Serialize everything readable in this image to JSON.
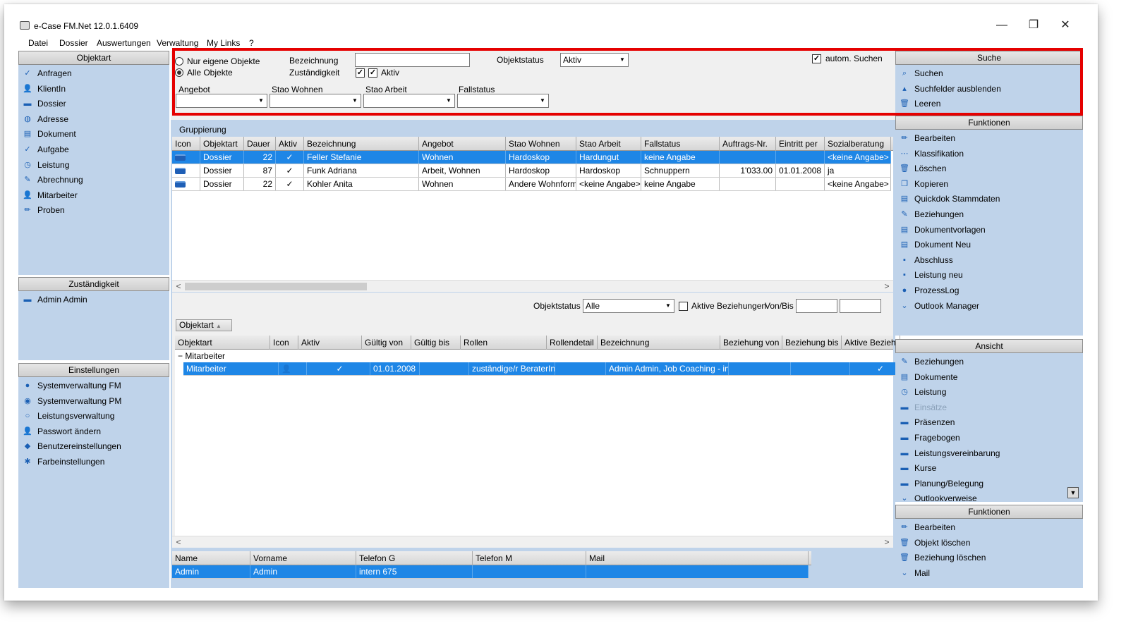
{
  "window": {
    "title": "e-Case FM.Net 12.0.1.6409",
    "min": "—",
    "max": "❐",
    "close": "✕"
  },
  "menu": [
    "Datei",
    "Dossier",
    "Auswertungen",
    "Verwaltung",
    "My Links",
    "?"
  ],
  "left": {
    "objektart": {
      "title": "Objektart",
      "items": [
        {
          "label": "Anfragen",
          "icon": "check-icon",
          "glyph": "✓"
        },
        {
          "label": "KlientIn",
          "icon": "person-icon",
          "glyph": "👤"
        },
        {
          "label": "Dossier",
          "icon": "dossier-icon",
          "glyph": "▬"
        },
        {
          "label": "Adresse",
          "icon": "globe-icon",
          "glyph": "◍"
        },
        {
          "label": "Dokument",
          "icon": "document-icon",
          "glyph": "▤"
        },
        {
          "label": "Aufgabe",
          "icon": "check-icon",
          "glyph": "✓"
        },
        {
          "label": "Leistung",
          "icon": "clock-icon",
          "glyph": "◷"
        },
        {
          "label": "Abrechnung",
          "icon": "invoice-icon",
          "glyph": "✎"
        },
        {
          "label": "Mitarbeiter",
          "icon": "person-icon",
          "glyph": "👤"
        },
        {
          "label": "Proben",
          "icon": "pen-icon",
          "glyph": "✏"
        }
      ]
    },
    "zustaendigkeit": {
      "title": "Zuständigkeit",
      "items": [
        {
          "label": "Admin Admin",
          "icon": "dossier-icon",
          "glyph": "▬"
        }
      ]
    },
    "einstellungen": {
      "title": "Einstellungen",
      "items": [
        {
          "label": "Systemverwaltung FM",
          "icon": "gear-icon",
          "glyph": "●"
        },
        {
          "label": "Systemverwaltung PM",
          "icon": "gear-icon",
          "glyph": "◉"
        },
        {
          "label": "Leistungsverwaltung",
          "icon": "settings-icon",
          "glyph": "○"
        },
        {
          "label": "Passwort ändern",
          "icon": "key-icon",
          "glyph": "👤"
        },
        {
          "label": "Benutzereinstellungen",
          "icon": "user-settings-icon",
          "glyph": "◆"
        },
        {
          "label": "Farbeinstellungen",
          "icon": "palette-icon",
          "glyph": "✱"
        }
      ]
    }
  },
  "filter": {
    "radio_own": "Nur eigene Objekte",
    "radio_all": "Alle Objekte",
    "bezeichnung_label": "Bezeichnung",
    "bezeichnung_value": "",
    "zustaendigkeit_label": "Zuständigkeit",
    "aktiv_label": "Aktiv",
    "objektstatus_label": "Objektstatus",
    "objektstatus_value": "Aktiv",
    "autom_label": "autom. Suchen",
    "angebot_label": "Angebot",
    "stao_wohnen_label": "Stao Wohnen",
    "stao_arbeit_label": "Stao Arbeit",
    "fallstatus_label": "Fallstatus",
    "gruppierung_label": "Gruppierung"
  },
  "grid1": {
    "columns": [
      "Icon",
      "Objektart",
      "Dauer",
      "Aktiv",
      "Bezeichnung",
      "Angebot",
      "Stao Wohnen",
      "Stao Arbeit",
      "Fallstatus",
      "Auftrags-Nr.",
      "Eintritt per",
      "Sozialberatung"
    ],
    "rows": [
      [
        "",
        "Dossier",
        "22",
        "✓",
        "Feller Stefanie",
        "Wohnen",
        "Hardoskop",
        "Hardungut",
        "keine Angabe",
        "",
        "",
        "<keine Angabe>"
      ],
      [
        "",
        "Dossier",
        "87",
        "✓",
        "Funk Adriana",
        "Arbeit, Wohnen",
        "Hardoskop",
        "Hardoskop",
        "Schnuppern",
        "1'033.00",
        "01.01.2008",
        "ja"
      ],
      [
        "",
        "Dossier",
        "22",
        "✓",
        "Kohler Anita",
        "Wohnen",
        "Andere Wohnform",
        "<keine Angabe>",
        "keine Angabe",
        "",
        "",
        "<keine Angabe>"
      ]
    ]
  },
  "mid": {
    "objektstatus_label": "Objektstatus",
    "objektstatus_value": "Alle",
    "aktive_label": "Aktive Beziehungen",
    "vonbis_label": "Von/Bis",
    "group_button": "Objektart"
  },
  "grid2": {
    "columns": [
      "Objektart",
      "Icon",
      "Aktiv",
      "Gültig von",
      "Gültig bis",
      "Rollen",
      "Rollendetail",
      "Bezeichnung",
      "Beziehung von",
      "Beziehung bis",
      "Aktive Beziehung"
    ],
    "group": "Mitarbeiter",
    "row": [
      "Mitarbeiter",
      "",
      "✓",
      "01.01.2008",
      "",
      "zuständige/r BeraterIn",
      "",
      "Admin Admin,  Job Coaching - int...",
      "",
      "",
      "✓"
    ]
  },
  "grid3": {
    "columns": [
      "Name",
      "Vorname",
      "Telefon G",
      "Telefon M",
      "Mail"
    ],
    "row": [
      "Admin",
      "Admin",
      "intern 675",
      "",
      ""
    ]
  },
  "right": {
    "suche": {
      "title": "Suche",
      "items": [
        {
          "label": "Suchen",
          "icon": "search-icon",
          "glyph": "⌕"
        },
        {
          "label": "Suchfelder ausblenden",
          "icon": "hide-icon",
          "glyph": "▴"
        },
        {
          "label": "Leeren",
          "icon": "trash-icon",
          "glyph": "🗑"
        }
      ]
    },
    "funktionen": {
      "title": "Funktionen",
      "items": [
        {
          "label": "Bearbeiten",
          "icon": "pen-icon",
          "glyph": "✏"
        },
        {
          "label": "Klassifikation",
          "icon": "dots-icon",
          "glyph": "⋯"
        },
        {
          "label": "Löschen",
          "icon": "trash-icon",
          "glyph": "🗑"
        },
        {
          "label": "Kopieren",
          "icon": "copy-icon",
          "glyph": "❐"
        },
        {
          "label": "Quickdok Stammdaten",
          "icon": "document-icon",
          "glyph": "▤"
        },
        {
          "label": "Beziehungen",
          "icon": "pen-icon",
          "glyph": "✎"
        },
        {
          "label": "Dokumentvorlagen",
          "icon": "document-icon",
          "glyph": "▤"
        },
        {
          "label": "Dokument Neu",
          "icon": "document-icon",
          "glyph": "▤"
        },
        {
          "label": "Abschluss",
          "icon": "flag-icon",
          "glyph": "▪"
        },
        {
          "label": "Leistung neu",
          "icon": "flag-icon",
          "glyph": "▪"
        },
        {
          "label": "ProzessLog",
          "icon": "log-icon",
          "glyph": "●"
        },
        {
          "label": "Outlook Manager",
          "icon": "chevron-down-icon",
          "glyph": "⌄"
        }
      ]
    },
    "ansicht": {
      "title": "Ansicht",
      "items": [
        {
          "label": "Beziehungen",
          "icon": "pen-icon",
          "glyph": "✎"
        },
        {
          "label": "Dokumente",
          "icon": "document-icon",
          "glyph": "▤"
        },
        {
          "label": "Leistung",
          "icon": "clock-icon",
          "glyph": "◷"
        },
        {
          "label": "Einsätze",
          "icon": "dossier-icon",
          "glyph": "▬",
          "disabled": true
        },
        {
          "label": "Präsenzen",
          "icon": "dossier-icon",
          "glyph": "▬"
        },
        {
          "label": "Fragebogen",
          "icon": "dossier-icon",
          "glyph": "▬"
        },
        {
          "label": "Leistungsvereinbarung",
          "icon": "dossier-icon",
          "glyph": "▬"
        },
        {
          "label": "Kurse",
          "icon": "dossier-icon",
          "glyph": "▬"
        },
        {
          "label": "Planung/Belegung",
          "icon": "dossier-icon",
          "glyph": "▬"
        },
        {
          "label": "Outlookverweise",
          "icon": "chevron-down-icon",
          "glyph": "⌄"
        }
      ]
    },
    "funktionen2": {
      "title": "Funktionen",
      "items": [
        {
          "label": "Bearbeiten",
          "icon": "pen-icon",
          "glyph": "✏"
        },
        {
          "label": "Objekt löschen",
          "icon": "trash-icon",
          "glyph": "🗑"
        },
        {
          "label": "Beziehung löschen",
          "icon": "trash-icon",
          "glyph": "🗑"
        },
        {
          "label": "Mail",
          "icon": "mail-icon",
          "glyph": "⌄"
        }
      ]
    }
  }
}
